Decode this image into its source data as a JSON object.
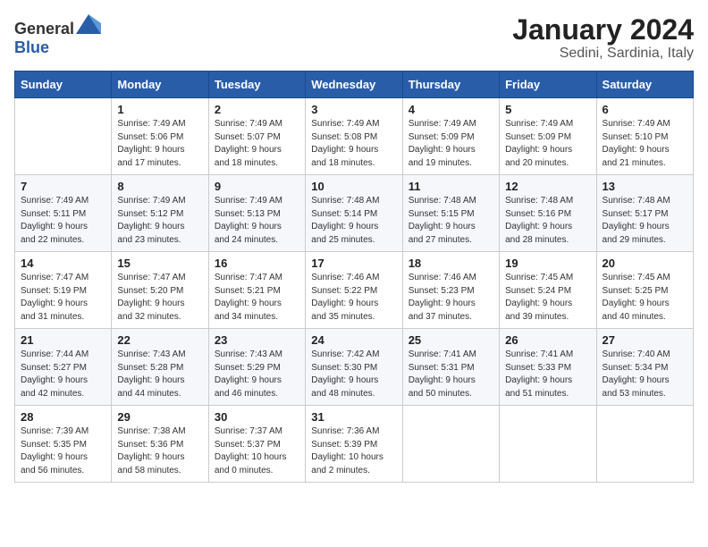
{
  "header": {
    "logo_general": "General",
    "logo_blue": "Blue",
    "title": "January 2024",
    "subtitle": "Sedini, Sardinia, Italy"
  },
  "days_of_week": [
    "Sunday",
    "Monday",
    "Tuesday",
    "Wednesday",
    "Thursday",
    "Friday",
    "Saturday"
  ],
  "weeks": [
    [
      {
        "day": "",
        "info": ""
      },
      {
        "day": "1",
        "info": "Sunrise: 7:49 AM\nSunset: 5:06 PM\nDaylight: 9 hours\nand 17 minutes."
      },
      {
        "day": "2",
        "info": "Sunrise: 7:49 AM\nSunset: 5:07 PM\nDaylight: 9 hours\nand 18 minutes."
      },
      {
        "day": "3",
        "info": "Sunrise: 7:49 AM\nSunset: 5:08 PM\nDaylight: 9 hours\nand 18 minutes."
      },
      {
        "day": "4",
        "info": "Sunrise: 7:49 AM\nSunset: 5:09 PM\nDaylight: 9 hours\nand 19 minutes."
      },
      {
        "day": "5",
        "info": "Sunrise: 7:49 AM\nSunset: 5:09 PM\nDaylight: 9 hours\nand 20 minutes."
      },
      {
        "day": "6",
        "info": "Sunrise: 7:49 AM\nSunset: 5:10 PM\nDaylight: 9 hours\nand 21 minutes."
      }
    ],
    [
      {
        "day": "7",
        "info": "Sunrise: 7:49 AM\nSunset: 5:11 PM\nDaylight: 9 hours\nand 22 minutes."
      },
      {
        "day": "8",
        "info": "Sunrise: 7:49 AM\nSunset: 5:12 PM\nDaylight: 9 hours\nand 23 minutes."
      },
      {
        "day": "9",
        "info": "Sunrise: 7:49 AM\nSunset: 5:13 PM\nDaylight: 9 hours\nand 24 minutes."
      },
      {
        "day": "10",
        "info": "Sunrise: 7:48 AM\nSunset: 5:14 PM\nDaylight: 9 hours\nand 25 minutes."
      },
      {
        "day": "11",
        "info": "Sunrise: 7:48 AM\nSunset: 5:15 PM\nDaylight: 9 hours\nand 27 minutes."
      },
      {
        "day": "12",
        "info": "Sunrise: 7:48 AM\nSunset: 5:16 PM\nDaylight: 9 hours\nand 28 minutes."
      },
      {
        "day": "13",
        "info": "Sunrise: 7:48 AM\nSunset: 5:17 PM\nDaylight: 9 hours\nand 29 minutes."
      }
    ],
    [
      {
        "day": "14",
        "info": "Sunrise: 7:47 AM\nSunset: 5:19 PM\nDaylight: 9 hours\nand 31 minutes."
      },
      {
        "day": "15",
        "info": "Sunrise: 7:47 AM\nSunset: 5:20 PM\nDaylight: 9 hours\nand 32 minutes."
      },
      {
        "day": "16",
        "info": "Sunrise: 7:47 AM\nSunset: 5:21 PM\nDaylight: 9 hours\nand 34 minutes."
      },
      {
        "day": "17",
        "info": "Sunrise: 7:46 AM\nSunset: 5:22 PM\nDaylight: 9 hours\nand 35 minutes."
      },
      {
        "day": "18",
        "info": "Sunrise: 7:46 AM\nSunset: 5:23 PM\nDaylight: 9 hours\nand 37 minutes."
      },
      {
        "day": "19",
        "info": "Sunrise: 7:45 AM\nSunset: 5:24 PM\nDaylight: 9 hours\nand 39 minutes."
      },
      {
        "day": "20",
        "info": "Sunrise: 7:45 AM\nSunset: 5:25 PM\nDaylight: 9 hours\nand 40 minutes."
      }
    ],
    [
      {
        "day": "21",
        "info": "Sunrise: 7:44 AM\nSunset: 5:27 PM\nDaylight: 9 hours\nand 42 minutes."
      },
      {
        "day": "22",
        "info": "Sunrise: 7:43 AM\nSunset: 5:28 PM\nDaylight: 9 hours\nand 44 minutes."
      },
      {
        "day": "23",
        "info": "Sunrise: 7:43 AM\nSunset: 5:29 PM\nDaylight: 9 hours\nand 46 minutes."
      },
      {
        "day": "24",
        "info": "Sunrise: 7:42 AM\nSunset: 5:30 PM\nDaylight: 9 hours\nand 48 minutes."
      },
      {
        "day": "25",
        "info": "Sunrise: 7:41 AM\nSunset: 5:31 PM\nDaylight: 9 hours\nand 50 minutes."
      },
      {
        "day": "26",
        "info": "Sunrise: 7:41 AM\nSunset: 5:33 PM\nDaylight: 9 hours\nand 51 minutes."
      },
      {
        "day": "27",
        "info": "Sunrise: 7:40 AM\nSunset: 5:34 PM\nDaylight: 9 hours\nand 53 minutes."
      }
    ],
    [
      {
        "day": "28",
        "info": "Sunrise: 7:39 AM\nSunset: 5:35 PM\nDaylight: 9 hours\nand 56 minutes."
      },
      {
        "day": "29",
        "info": "Sunrise: 7:38 AM\nSunset: 5:36 PM\nDaylight: 9 hours\nand 58 minutes."
      },
      {
        "day": "30",
        "info": "Sunrise: 7:37 AM\nSunset: 5:37 PM\nDaylight: 10 hours\nand 0 minutes."
      },
      {
        "day": "31",
        "info": "Sunrise: 7:36 AM\nSunset: 5:39 PM\nDaylight: 10 hours\nand 2 minutes."
      },
      {
        "day": "",
        "info": ""
      },
      {
        "day": "",
        "info": ""
      },
      {
        "day": "",
        "info": ""
      }
    ]
  ]
}
